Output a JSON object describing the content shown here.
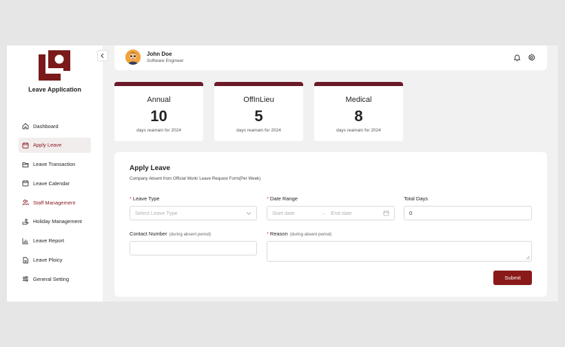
{
  "app": {
    "title": "Leave Application",
    "brand_color": "#8a1a22"
  },
  "sidebar": {
    "items": [
      {
        "label": "Dashboard",
        "icon": "home-icon"
      },
      {
        "label": "Apply Leave",
        "icon": "calendar-edit-icon",
        "active": true
      },
      {
        "label": "Leave Transaction",
        "icon": "folder-icon"
      },
      {
        "label": "Leave Calendar",
        "icon": "calendar-icon"
      },
      {
        "label": "Staff Management",
        "icon": "users-icon"
      },
      {
        "label": "Holiday Management",
        "icon": "hand-icon"
      },
      {
        "label": "Leave Report",
        "icon": "chart-icon"
      },
      {
        "label": "Leave Ploicy",
        "icon": "document-icon"
      },
      {
        "label": "General Setting",
        "icon": "sliders-icon"
      }
    ]
  },
  "header": {
    "user_name": "John Doe",
    "user_role": "Software Engineer"
  },
  "cards": [
    {
      "title": "Annual",
      "value": "10",
      "subtitle": "days reamain for 2024"
    },
    {
      "title": "OffInLieu",
      "value": "5",
      "subtitle": "days reamain for 2024"
    },
    {
      "title": "Medical",
      "value": "8",
      "subtitle": "days reamain for 2024"
    }
  ],
  "form": {
    "title": "Apply Leave",
    "subtitle": "Company Absent from Official Work/ Leave Request Form(Per Week)",
    "leave_type_label": "Leave Type",
    "leave_type_placeholder": "Select Leave Type",
    "date_range_label": "Date Range",
    "start_placeholder": "Start date",
    "end_placeholder": "End date",
    "total_days_label": "Total Days",
    "total_days_value": "0",
    "contact_label": "Contact Number",
    "contact_hint": "(during absent period)",
    "reason_label": "Reason",
    "reason_hint": "(during absent period)",
    "submit_label": "Submit"
  }
}
